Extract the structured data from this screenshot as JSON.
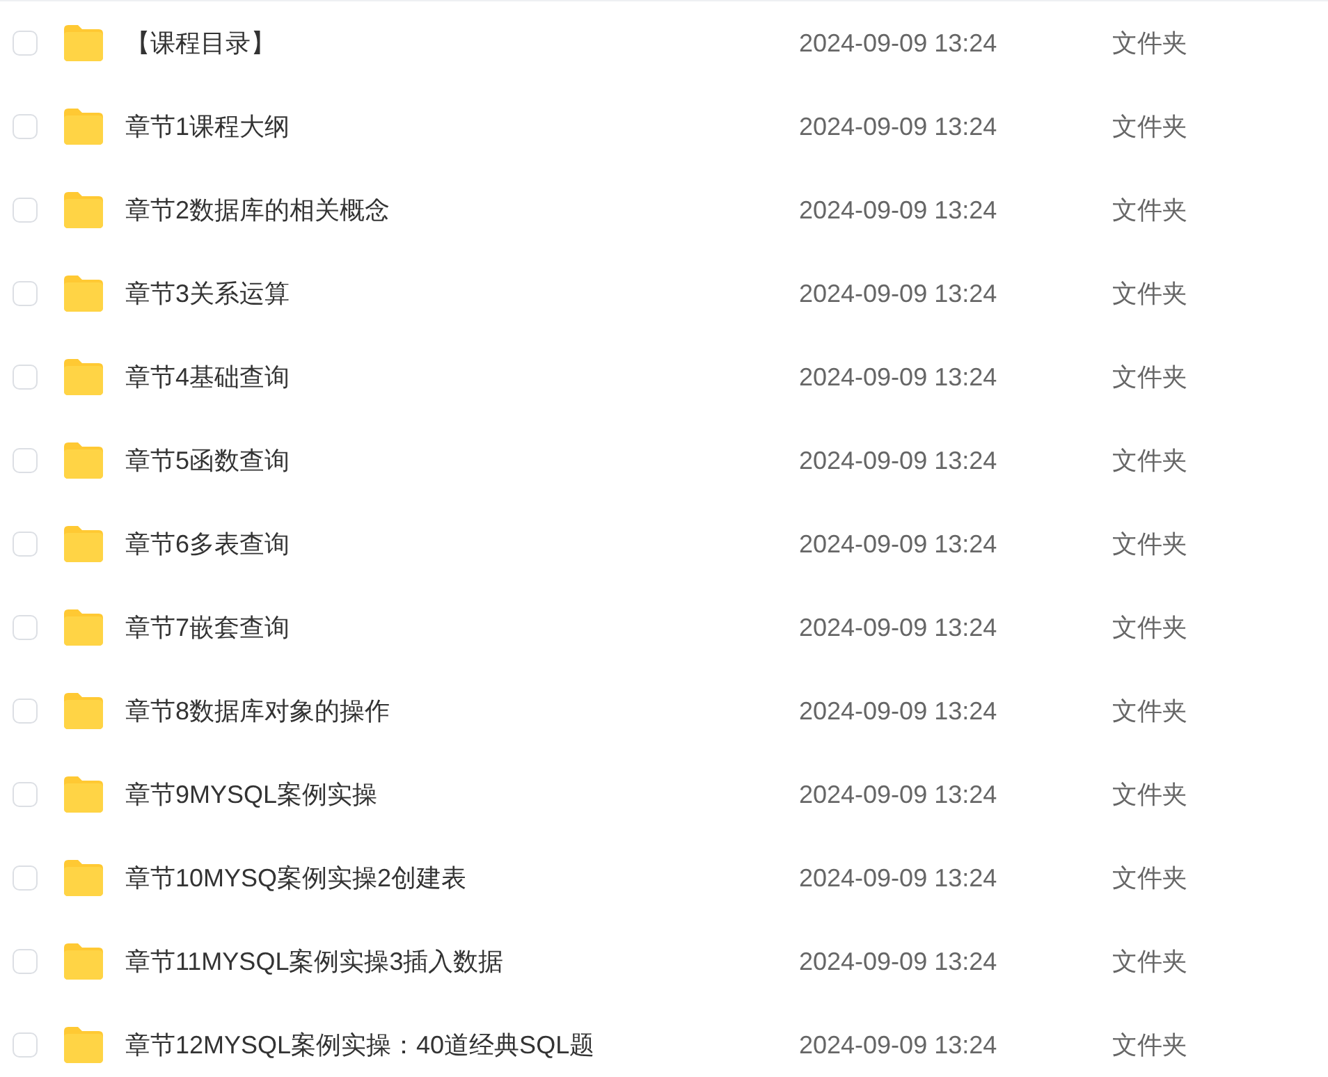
{
  "files": [
    {
      "name": "【课程目录】",
      "date": "2024-09-09 13:24",
      "type": "文件夹",
      "checked": false
    },
    {
      "name": "章节1课程大纲",
      "date": "2024-09-09 13:24",
      "type": "文件夹",
      "checked": false
    },
    {
      "name": "章节2数据库的相关概念",
      "date": "2024-09-09 13:24",
      "type": "文件夹",
      "checked": false
    },
    {
      "name": "章节3关系运算",
      "date": "2024-09-09 13:24",
      "type": "文件夹",
      "checked": false
    },
    {
      "name": "章节4基础查询",
      "date": "2024-09-09 13:24",
      "type": "文件夹",
      "checked": false
    },
    {
      "name": "章节5函数查询",
      "date": "2024-09-09 13:24",
      "type": "文件夹",
      "checked": false
    },
    {
      "name": "章节6多表查询",
      "date": "2024-09-09 13:24",
      "type": "文件夹",
      "checked": false
    },
    {
      "name": "章节7嵌套查询",
      "date": "2024-09-09 13:24",
      "type": "文件夹",
      "checked": false
    },
    {
      "name": "章节8数据库对象的操作",
      "date": "2024-09-09 13:24",
      "type": "文件夹",
      "checked": false
    },
    {
      "name": "章节9MYSQL案例实操",
      "date": "2024-09-09 13:24",
      "type": "文件夹",
      "checked": false
    },
    {
      "name": "章节10MYSQ案例实操2创建表",
      "date": "2024-09-09 13:24",
      "type": "文件夹",
      "checked": false
    },
    {
      "name": "章节11MYSQL案例实操3插入数据",
      "date": "2024-09-09 13:24",
      "type": "文件夹",
      "checked": false
    },
    {
      "name": "章节12MYSQL案例实操：40道经典SQL题",
      "date": "2024-09-09 13:24",
      "type": "文件夹",
      "checked": false
    }
  ]
}
